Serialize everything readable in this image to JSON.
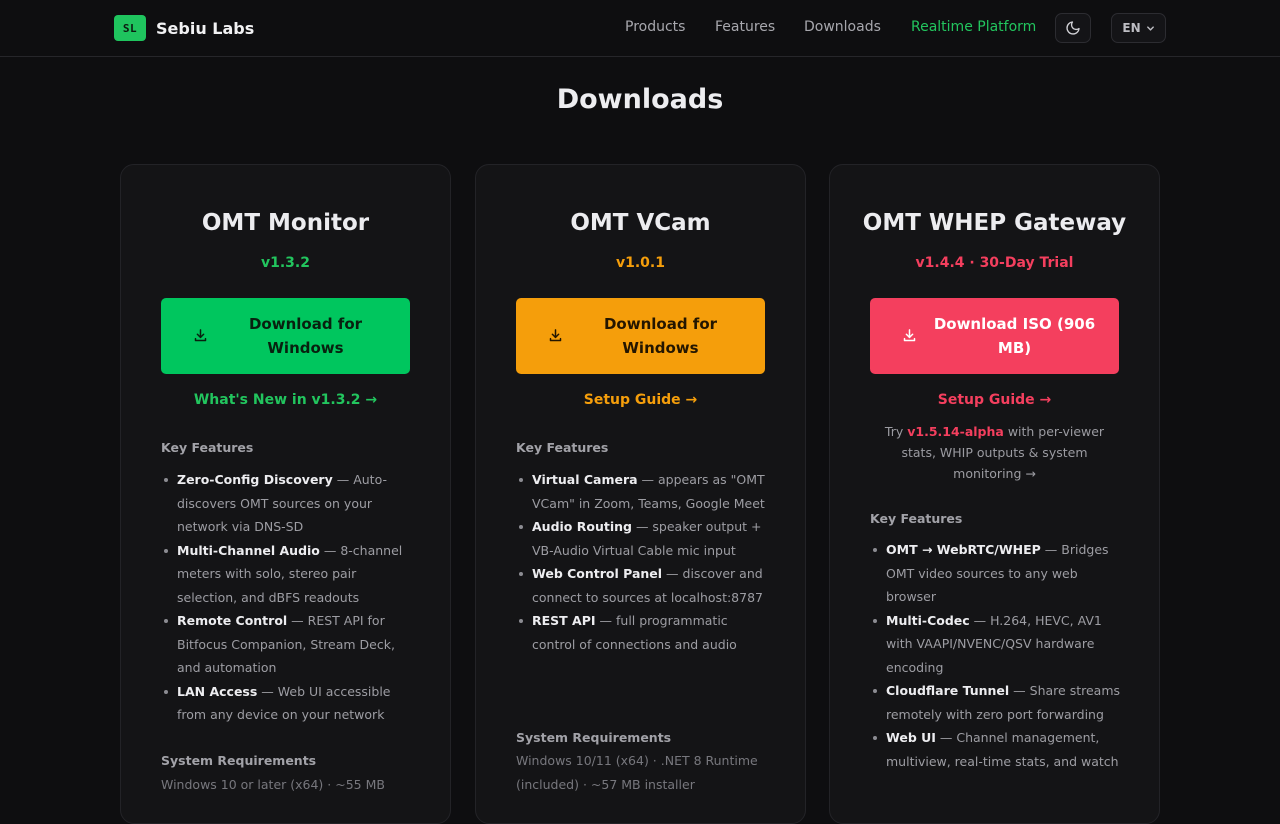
{
  "header": {
    "logo_text": "SL",
    "brand_name": "Sebiu Labs",
    "nav": [
      {
        "label": "Products",
        "active": false
      },
      {
        "label": "Features",
        "active": false
      },
      {
        "label": "Downloads",
        "active": false
      },
      {
        "label": "Realtime Platform",
        "active": true
      }
    ],
    "theme_icon": "moon-icon",
    "language": "EN"
  },
  "page": {
    "title": "Downloads"
  },
  "cards": [
    {
      "title": "OMT Monitor",
      "version": "v1.3.2",
      "accent": "#22c55e",
      "button_bg": "#00c65e",
      "button_label": "Download for Windows",
      "link": "What's New in v1.3.2 →",
      "features_heading": "Key Features",
      "features": [
        {
          "name": "Zero-Config Discovery",
          "desc": " — Auto-discovers OMT sources on your network via DNS-SD"
        },
        {
          "name": "Multi-Channel Audio",
          "desc": " — 8-channel meters with solo, stereo pair selection, and dBFS readouts"
        },
        {
          "name": "Remote Control",
          "desc": " — REST API for Bitfocus Companion, Stream Deck, and automation"
        },
        {
          "name": "LAN Access",
          "desc": " — Web UI accessible from any device on your network"
        }
      ],
      "requirements_heading": "System Requirements",
      "requirements": "Windows 10 or later (x64) · ~55 MB"
    },
    {
      "title": "OMT VCam",
      "version": "v1.0.1",
      "accent": "#f59e0b",
      "button_bg": "#f59e0b",
      "button_label": "Download for Windows",
      "link": "Setup Guide →",
      "features_heading": "Key Features",
      "features": [
        {
          "name": "Virtual Camera",
          "desc": " — appears as \"OMT VCam\" in Zoom, Teams, Google Meet"
        },
        {
          "name": "Audio Routing",
          "desc": " — speaker output + VB-Audio Virtual Cable mic input"
        },
        {
          "name": "Web Control Panel",
          "desc": " — discover and connect to sources at localhost:8787"
        },
        {
          "name": "REST API",
          "desc": " — full programmatic control of connections and audio"
        }
      ],
      "requirements_heading": "System Requirements",
      "requirements": "Windows 10/11 (x64) · .NET 8 Runtime (included) · ~57 MB installer"
    },
    {
      "title": "OMT WHEP Gateway",
      "version": "v1.4.4 · 30-Day Trial",
      "accent": "#f43f5e",
      "button_bg": "#f43f5e",
      "button_label": "Download ISO (906 MB)",
      "link": "Setup Guide →",
      "try_prefix": "Try ",
      "try_version": "v1.5.14-alpha",
      "try_suffix": " with per-viewer stats, WHIP outputs & system monitoring →",
      "features_heading": "Key Features",
      "features": [
        {
          "name": "OMT → WebRTC/WHEP",
          "desc": " — Bridges OMT video sources to any web browser"
        },
        {
          "name": "Multi-Codec",
          "desc": " — H.264, HEVC, AV1 with VAAPI/NVENC/QSV hardware encoding"
        },
        {
          "name": "Cloudflare Tunnel",
          "desc": " — Share streams remotely with zero port forwarding"
        },
        {
          "name": "Web UI",
          "desc": " — Channel management, multiview, real-time stats, and watch"
        }
      ],
      "requirements_heading": "",
      "requirements": ""
    }
  ]
}
